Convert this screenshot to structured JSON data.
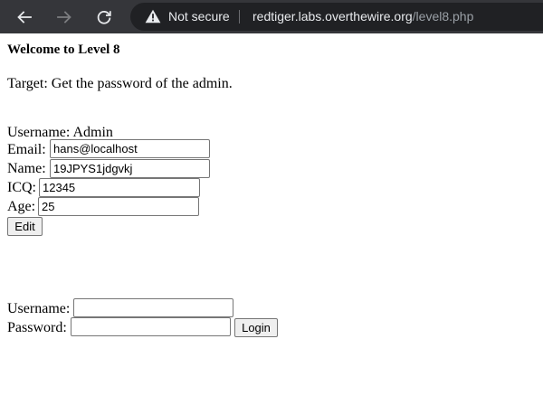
{
  "browser": {
    "icons": {
      "back": "arrow-left-icon",
      "forward": "arrow-right-icon",
      "reload": "reload-icon",
      "security": "warning-triangle-icon"
    },
    "security_label": "Not secure",
    "url_host": "redtiger.labs.overthewire.org",
    "url_path": "/level8.php",
    "colors": {
      "chrome": "#35363a",
      "omnibox": "#202124",
      "text": "#e8eaed",
      "muted": "#9aa0a6"
    }
  },
  "page": {
    "heading": "Welcome to Level 8",
    "target": "Target: Get the password of the admin.",
    "profile": {
      "username_label": "Username:",
      "username_value": "Admin",
      "email_label": "Email:",
      "email_value": "hans@localhost",
      "name_label": "Name:",
      "name_value": "19JPYS1jdgvkj",
      "icq_label": "ICQ:",
      "icq_value": "12345",
      "age_label": "Age:",
      "age_value": "25",
      "edit_button": "Edit"
    },
    "login": {
      "username_label": "Username:",
      "username_value": "",
      "password_label": "Password:",
      "password_value": "",
      "login_button": "Login"
    }
  }
}
